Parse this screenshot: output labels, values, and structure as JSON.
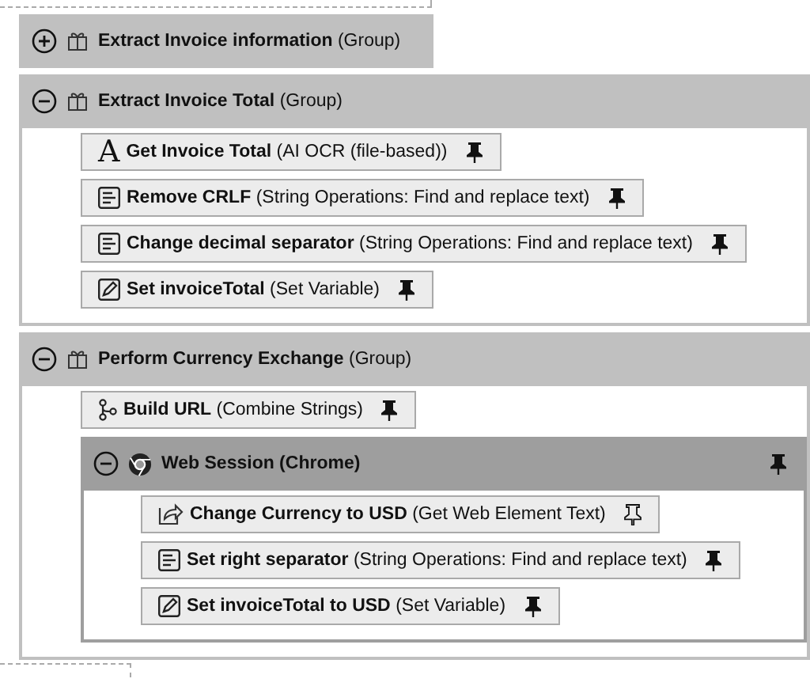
{
  "groups": [
    {
      "kind": "group",
      "name": "Extract Invoice information",
      "type": "(Group)",
      "expanded": false
    },
    {
      "kind": "group",
      "name": "Extract Invoice Total",
      "type": "(Group)",
      "expanded": true,
      "items": [
        {
          "kind": "ocr",
          "glyph": "A",
          "name": "Get Invoice Total",
          "type": "(AI OCR (file-based))",
          "pinned": true
        },
        {
          "kind": "replace",
          "name": "Remove CRLF",
          "type": "(String Operations: Find and replace text)",
          "pinned": true
        },
        {
          "kind": "replace",
          "name": "Change decimal separator",
          "type": "(String Operations: Find and replace text)",
          "pinned": true
        },
        {
          "kind": "variable",
          "name": "Set invoiceTotal",
          "type": "(Set Variable)",
          "pinned": true
        }
      ]
    },
    {
      "kind": "group",
      "name": "Perform Currency Exchange",
      "type": "(Group)",
      "expanded": true,
      "items": [
        {
          "kind": "combine",
          "name": "Build URL",
          "type": "(Combine Strings)",
          "pinned": true
        },
        {
          "kind": "session",
          "name": "Web Session (Chrome)",
          "expanded": true,
          "pinned": true,
          "items": [
            {
              "kind": "webtext",
              "name": "Change Currency to USD",
              "type": "(Get Web Element Text)",
              "pinned": false
            },
            {
              "kind": "replace",
              "name": "Set right separator",
              "type": "(String Operations: Find and replace text)",
              "pinned": true
            },
            {
              "kind": "variable",
              "name": "Set invoiceTotal to USD",
              "type": "(Set Variable)",
              "pinned": true
            }
          ]
        }
      ]
    }
  ]
}
